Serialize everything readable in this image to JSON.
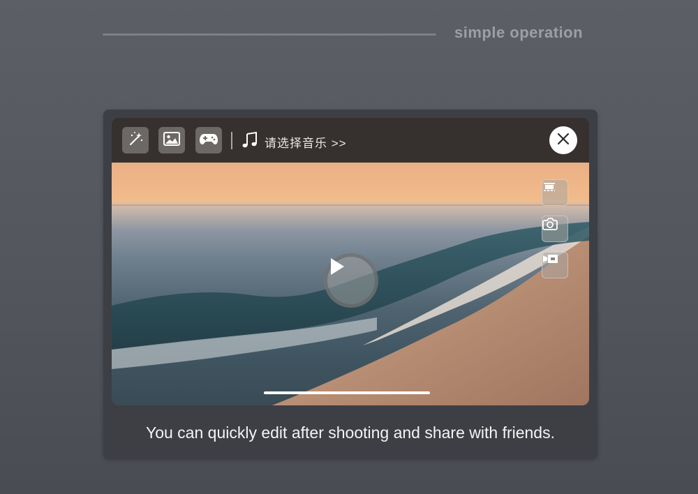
{
  "header": {
    "title": "simple operation"
  },
  "toolbar": {
    "tools": [
      {
        "icon": "magic-wand-icon"
      },
      {
        "icon": "image-icon"
      },
      {
        "icon": "gamepad-icon"
      }
    ],
    "music_icon": "music-note-icon",
    "music_label": "请选择音乐 >>",
    "close_icon": "close-icon"
  },
  "video": {
    "side_buttons": [
      {
        "icon": "crop-icon"
      },
      {
        "icon": "camera-icon"
      },
      {
        "icon": "video-camera-icon"
      }
    ],
    "play_icon": "play-icon"
  },
  "caption": "You can quickly edit after shooting and share with friends."
}
